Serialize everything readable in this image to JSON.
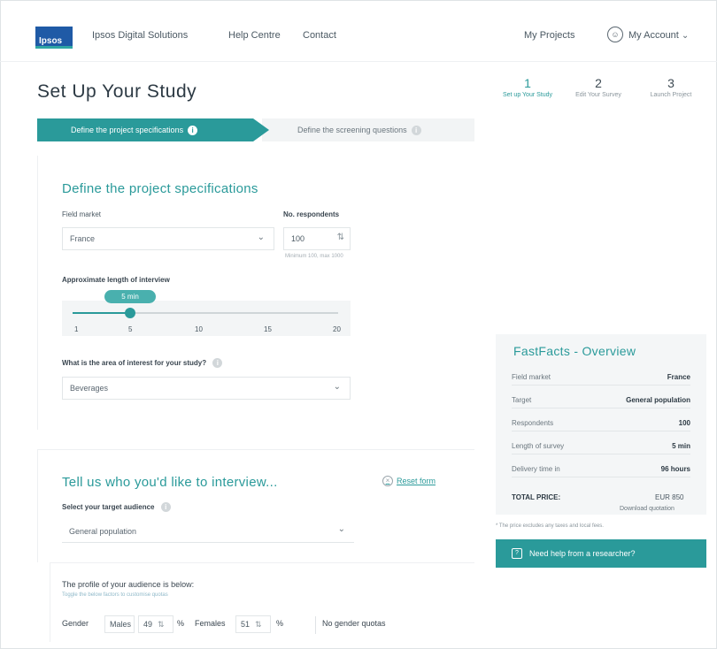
{
  "nav": {
    "logo": "Ipsos",
    "links": [
      "Ipsos Digital Solutions",
      "Help Centre",
      "Contact"
    ],
    "my_projects": "My Projects",
    "my_account": "My Account"
  },
  "page_title": "Set Up Your Study",
  "steps": [
    {
      "num": "1",
      "label": "Set up Your Study"
    },
    {
      "num": "2",
      "label": "Edit Your Survey"
    },
    {
      "num": "3",
      "label": "Launch Project"
    }
  ],
  "tabs": {
    "active": "Define the project specifications",
    "inactive": "Define the screening questions"
  },
  "specs": {
    "title": "Define the project specifications",
    "field_market_label": "Field market",
    "field_market_value": "France",
    "respondents_label": "No. respondents",
    "respondents_value": "100",
    "respondents_hint": "Minimum 100, max 1000",
    "loi_label": "Approximate length of interview",
    "loi_value": "5 min",
    "loi_fraction": 0.2,
    "loi_ticks": [
      "1",
      "5",
      "10",
      "15",
      "20"
    ],
    "area_label": "What is the area of interest for your study?",
    "area_value": "Beverages"
  },
  "audience": {
    "title": "Tell us who you'd like to interview...",
    "reset": "Reset form",
    "target_label": "Select your target audience",
    "target_value": "General population",
    "profile_label": "The profile of your audience is below:",
    "profile_hint": "Toggle the below factors to customise quotas",
    "gender_label": "Gender",
    "male_label": "Males",
    "male_value": "49",
    "female_label": "Females",
    "female_value": "51",
    "pct": "%",
    "no_quotas": "No gender quotas"
  },
  "fastfacts": {
    "title": "FastFacts - Overview",
    "rows": [
      {
        "k": "Field market",
        "v": "France"
      },
      {
        "k": "Target",
        "v": "General population"
      },
      {
        "k": "Respondents",
        "v": "100"
      },
      {
        "k": "Length of survey",
        "v": "5 min"
      },
      {
        "k": "Delivery time in",
        "v": "96 hours"
      }
    ],
    "total_label": "TOTAL PRICE:",
    "total_value": "EUR 850",
    "download": "Download quotation",
    "note": "* The price excludes any taxes and local fees.",
    "help": "Need help from a researcher?"
  }
}
